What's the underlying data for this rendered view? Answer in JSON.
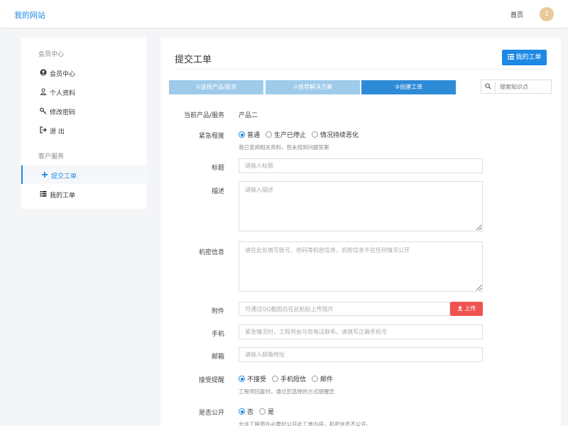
{
  "header": {
    "brand": "我的网站",
    "home_link": "首页",
    "avatar_initial": "1"
  },
  "sidebar": {
    "groups": [
      {
        "title": "会员中心",
        "items": [
          {
            "label": "会员中心",
            "icon": "user-circle-icon"
          },
          {
            "label": "个人资料",
            "icon": "user-icon"
          },
          {
            "label": "修改密码",
            "icon": "key-icon"
          },
          {
            "label": "退 出",
            "icon": "logout-icon"
          }
        ]
      },
      {
        "title": "客户服务",
        "items": [
          {
            "label": "提交工单",
            "icon": "plus-icon",
            "active": true
          },
          {
            "label": "我的工单",
            "icon": "list-icon"
          }
        ]
      }
    ]
  },
  "main": {
    "title": "提交工单",
    "my_ticket_button": "我的工单",
    "steps": [
      "①选择产品/服务",
      "②推荐解决方案",
      "③创建工单"
    ],
    "current_step": 3,
    "kb_search_placeholder": "搜索知识点",
    "form": {
      "product": {
        "label": "当前产品/服务",
        "value": "产品二"
      },
      "urgency": {
        "label": "紧急程度",
        "options": [
          "普通",
          "生产已停止",
          "情况持续恶化"
        ],
        "selected": "普通",
        "hint": "我已查阅相关资料，但未找到问题答案"
      },
      "title": {
        "label": "标题",
        "placeholder": "请输入标题"
      },
      "description": {
        "label": "描述",
        "placeholder": "请输入描述"
      },
      "secret": {
        "label": "机密信息",
        "placeholder": "请在此处填写账号、密码等机密信息，机密信息不在任何情况公开"
      },
      "attachment": {
        "label": "附件",
        "placeholder": "可通过QQ截图后在此粘贴上传图片",
        "upload_label": "上传"
      },
      "phone": {
        "label": "手机",
        "placeholder": "紧急情况时，工程师会与您电话联系，请填写正确手机号"
      },
      "email": {
        "label": "邮箱",
        "placeholder": "请输入邮箱地址"
      },
      "reminder": {
        "label": "接受提醒",
        "options": [
          "不接受",
          "手机短信",
          "邮件"
        ],
        "selected": "不接受",
        "hint": "工程师回复时，通过您选择的方式提醒您"
      },
      "public": {
        "label": "是否公开",
        "options": [
          "否",
          "是"
        ],
        "selected": "否",
        "hint": "允许工程师在必要时公开此工单内容，机密信息不公开。"
      }
    }
  },
  "colors": {
    "primary": "#1e88e5",
    "step_done": "#9fcbea",
    "step_current": "#2e8bd8",
    "upload": "#ef5350",
    "avatar": "#e9c99a"
  }
}
